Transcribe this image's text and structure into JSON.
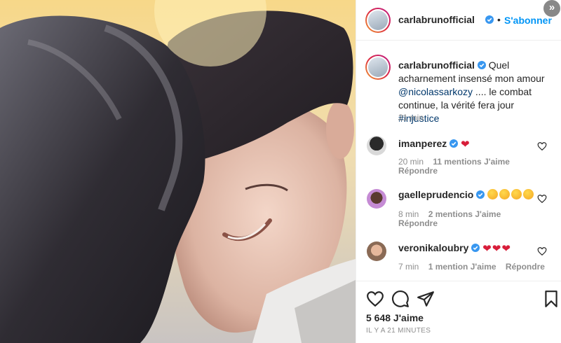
{
  "post": {
    "author": "carlabrunofficial",
    "follow_dot": "•",
    "follow_label": "S'abonner",
    "caption_author": "carlabrunofficial",
    "caption_part1": " Quel acharnement insensé mon amour ",
    "caption_mention": "@nicolassarkozy",
    "caption_part2": " .... le combat continue, la vérité fera jour ",
    "caption_hashtag": "#injustice",
    "caption_time": "21 min",
    "likes": "5 648 J'aime",
    "posted_ago": "IL Y A 21 MINUTES"
  },
  "comments": [
    {
      "user": "imanperez",
      "emojis": [
        "heart"
      ],
      "time": "20 min",
      "likes": "11 mentions J'aime",
      "reply": "Répondre"
    },
    {
      "user": "gaelleprudencio",
      "emojis": [
        "kiss-face",
        "kiss-face",
        "kiss-face",
        "kiss-face"
      ],
      "time": "8 min",
      "likes": "2 mentions J'aime",
      "reply": "Répondre"
    },
    {
      "user": "veronikaloubry",
      "emojis": [
        "heart",
        "heart",
        "heart"
      ],
      "time": "7 min",
      "likes": "1 mention J'aime",
      "reply": "Répondre"
    }
  ],
  "icons": {
    "like": "heart-outline-icon",
    "comment": "speech-bubble-icon",
    "share": "paper-plane-icon",
    "save": "bookmark-icon",
    "next": "double-chevron-right-icon",
    "verified": "verified-badge-icon"
  },
  "colors": {
    "accent_blue": "#0095f6",
    "link_navy": "#00376b",
    "verified_blue": "#3897f0",
    "heart_red": "#d81e3a",
    "meta_gray": "#8e8e8e"
  }
}
